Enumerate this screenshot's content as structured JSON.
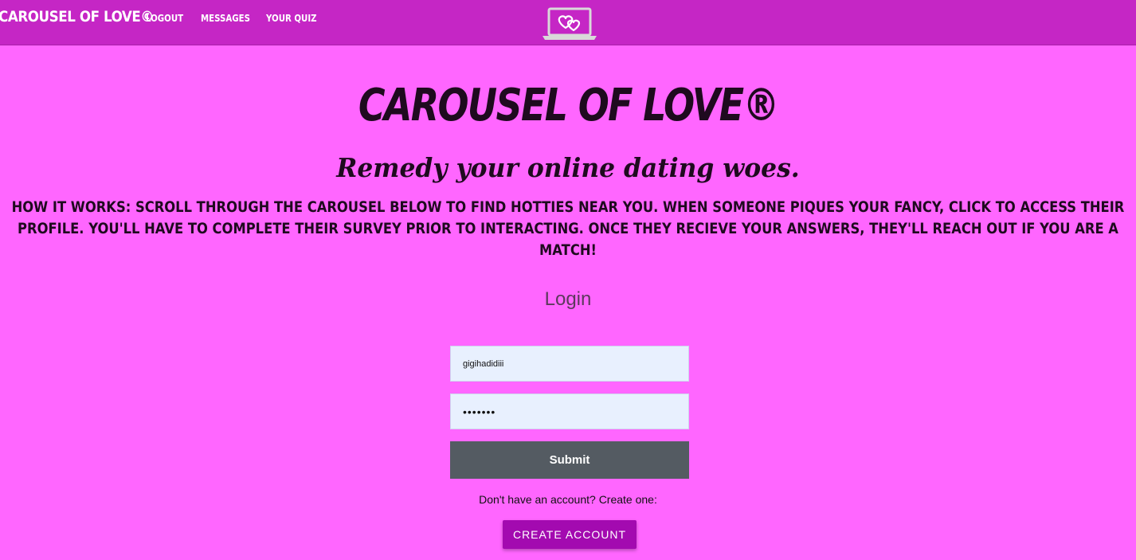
{
  "nav": {
    "brand": "CAROUSEL OF LOVE©",
    "links": [
      {
        "label": "LOGOUT"
      },
      {
        "label": "MESSAGES"
      },
      {
        "label": "YOUR QUIZ"
      }
    ],
    "logo_icon": "laptop-heart-icon"
  },
  "hero": {
    "title": "CAROUSEL OF LOVE®",
    "tagline": "Remedy your online dating woes.",
    "how_it_works": "HOW IT WORKS: SCROLL THROUGH THE CAROUSEL BELOW TO FIND HOTTIES NEAR YOU. WHEN SOMEONE PIQUES YOUR FANCY, CLICK TO ACCESS THEIR PROFILE. YOU'LL HAVE TO COMPLETE THEIR SURVEY PRIOR TO INTERACTING. ONCE THEY RECIEVE YOUR ANSWERS, THEY'LL REACH OUT IF YOU ARE A MATCH!"
  },
  "login": {
    "title": "Login",
    "username_value": "gigihadidiii",
    "password_value": "•••••••",
    "submit_label": "Submit",
    "signup_prompt": "Don't have an account? Create one:",
    "create_account_label": "CREATE ACCOUNT"
  },
  "colors": {
    "page_background": "#ff66ff",
    "navbar": "#c526c5",
    "submit_button": "#545b62",
    "create_button": "#a30ab0",
    "input_background": "#e8f0fe"
  }
}
